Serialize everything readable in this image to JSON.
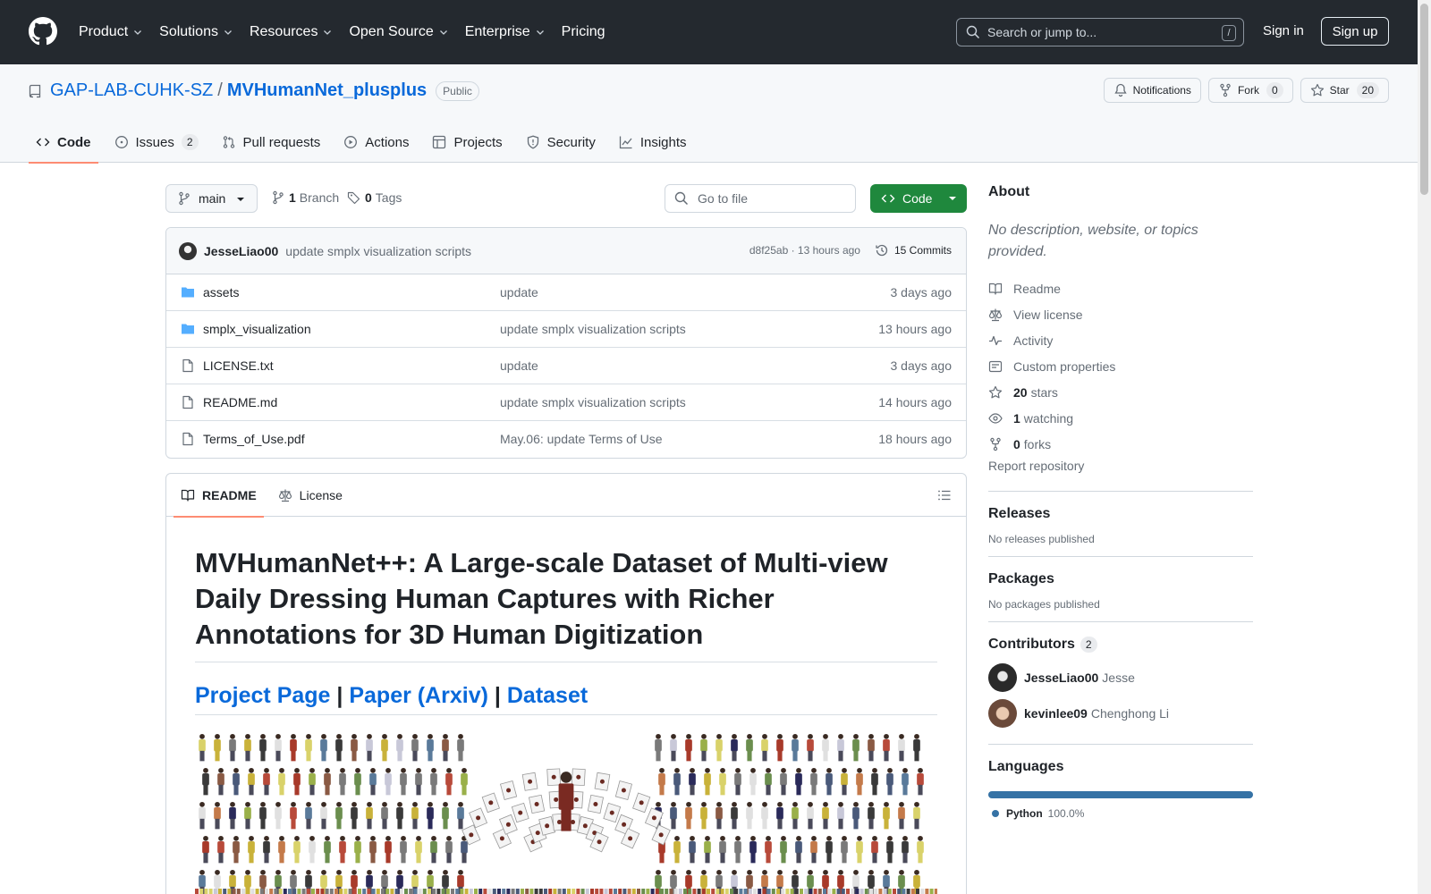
{
  "header": {
    "nav": [
      "Product",
      "Solutions",
      "Resources",
      "Open Source",
      "Enterprise",
      "Pricing"
    ],
    "search_placeholder": "Search or jump to...",
    "search_key": "/",
    "sign_in": "Sign in",
    "sign_up": "Sign up"
  },
  "repo": {
    "owner": "GAP-LAB-CUHK-SZ",
    "separator": "/",
    "name": "MVHumanNet_plusplus",
    "visibility": "Public",
    "notifications_label": "Notifications",
    "fork_label": "Fork",
    "fork_count": "0",
    "star_label": "Star",
    "star_count": "20",
    "tabs": [
      {
        "label": "Code"
      },
      {
        "label": "Issues",
        "count": "2"
      },
      {
        "label": "Pull requests"
      },
      {
        "label": "Actions"
      },
      {
        "label": "Projects"
      },
      {
        "label": "Security"
      },
      {
        "label": "Insights"
      }
    ]
  },
  "toolbar": {
    "branch": "main",
    "branches_count": "1",
    "branches_label": "Branch",
    "tags_count": "0",
    "tags_label": "Tags",
    "goto_placeholder": "Go to file",
    "code_button": "Code"
  },
  "commit": {
    "author": "JesseLiao00",
    "message": "update smplx visualization scripts",
    "hash_time": "d8f25ab · 13 hours ago",
    "commits_label": "15 Commits"
  },
  "files": [
    {
      "type": "dir",
      "name": "assets",
      "message": "update",
      "time": "3 days ago"
    },
    {
      "type": "dir",
      "name": "smplx_visualization",
      "message": "update smplx visualization scripts",
      "time": "13 hours ago"
    },
    {
      "type": "file",
      "name": "LICENSE.txt",
      "message": "update",
      "time": "3 days ago"
    },
    {
      "type": "file",
      "name": "README.md",
      "message": "update smplx visualization scripts",
      "time": "14 hours ago"
    },
    {
      "type": "file",
      "name": "Terms_of_Use.pdf",
      "message": "May.06: update Terms of Use",
      "time": "18 hours ago"
    }
  ],
  "readme": {
    "tab_readme": "README",
    "tab_license": "License",
    "title": "MVHumanNet++: A Large-scale Dataset of Multi-view Daily Dressing Human Captures with Richer Annotations for 3D Human Digitization",
    "links": {
      "project_page": "Project Page",
      "sep1": " | ",
      "paper": "Paper (Arxiv)",
      "sep2": " | ",
      "dataset": "Dataset"
    }
  },
  "sidebar": {
    "about_title": "About",
    "description": "No description, website, or topics provided.",
    "links": [
      {
        "icon": "book-icon",
        "label": "Readme"
      },
      {
        "icon": "law-icon",
        "label": "View license"
      },
      {
        "icon": "pulse-icon",
        "label": "Activity"
      },
      {
        "icon": "note-icon",
        "label": "Custom properties"
      },
      {
        "icon": "star-icon",
        "count": "20",
        "label": "stars"
      },
      {
        "icon": "eye-icon",
        "count": "1",
        "label": "watching"
      },
      {
        "icon": "fork-icon",
        "count": "0",
        "label": "forks"
      }
    ],
    "report": "Report repository",
    "releases_title": "Releases",
    "releases_note": "No releases published",
    "packages_title": "Packages",
    "packages_note": "No packages published",
    "contributors_title": "Contributors",
    "contributors_count": "2",
    "contributors": [
      {
        "login": "JesseLiao00",
        "name": "Jesse"
      },
      {
        "login": "kevinlee09",
        "name": "Chenghong Li"
      }
    ],
    "languages_title": "Languages",
    "languages": [
      {
        "name": "Python",
        "percent": "100.0%",
        "color": "#3572A5"
      }
    ]
  },
  "colors": {
    "header_bg": "#24292f",
    "link": "#0969da",
    "code_button": "#1f883d",
    "tab_underline": "#fd8c73"
  }
}
